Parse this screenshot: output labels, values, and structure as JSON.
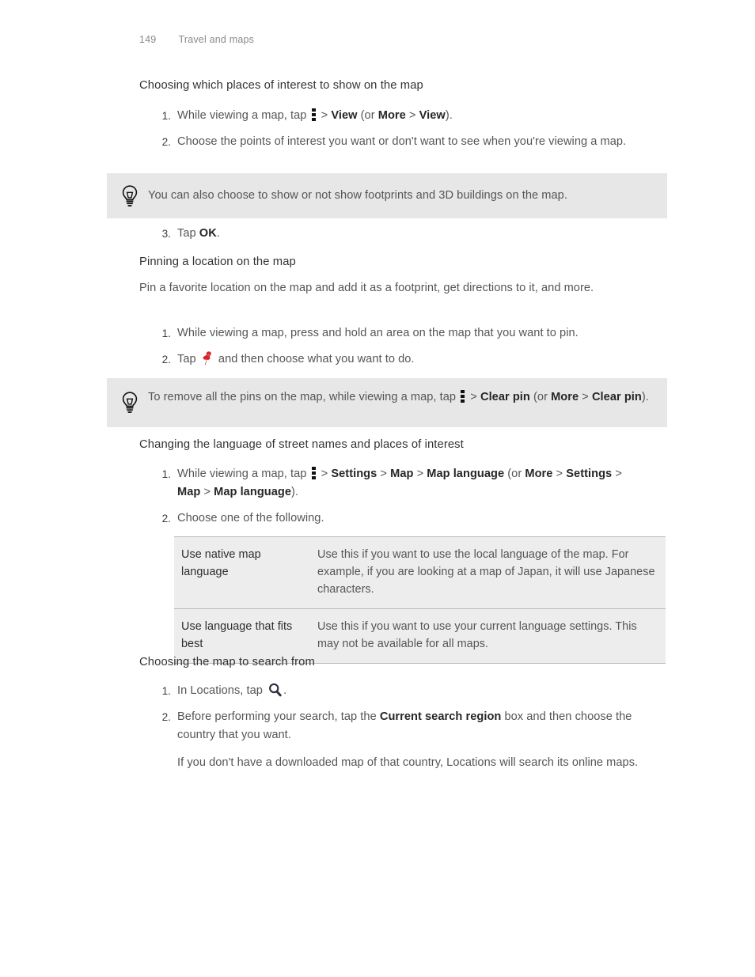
{
  "header": {
    "page_number": "149",
    "chapter": "Travel and maps"
  },
  "sections": [
    {
      "heading": "Choosing which places of interest to show on the map",
      "steps": [
        {
          "marker": "1.",
          "parts": [
            {
              "t": "text",
              "v": "While viewing a map, tap "
            },
            {
              "t": "icon",
              "v": "overflow-menu-icon"
            },
            {
              "t": "text",
              "v": " > "
            },
            {
              "t": "bold",
              "v": "View"
            },
            {
              "t": "text",
              "v": " (or "
            },
            {
              "t": "bold",
              "v": "More"
            },
            {
              "t": "text",
              "v": " > "
            },
            {
              "t": "bold",
              "v": "View"
            },
            {
              "t": "text",
              "v": ")."
            }
          ]
        },
        {
          "marker": "2.",
          "parts": [
            {
              "t": "text",
              "v": "Choose the points of interest you want or don't want to see when you're viewing a map."
            }
          ]
        }
      ]
    }
  ],
  "tip_1": {
    "icon": "lightbulb-icon",
    "text": "You can also choose to show or not show footprints and 3D buildings on the map."
  },
  "step_ok": {
    "marker": "3.",
    "pre": "Tap ",
    "bold": "OK",
    "post": "."
  },
  "section_pinning": {
    "heading": "Pinning a location on the map",
    "intro": "Pin a favorite location on the map and add it as a footprint, get directions to it, and more.",
    "steps": [
      {
        "marker": "1.",
        "text": "While viewing a map, press and hold an area on the map that you want to pin."
      },
      {
        "marker": "2.",
        "pre": "Tap ",
        "icon": "map-pin-icon",
        "post": " and then choose what you want to do."
      }
    ]
  },
  "tip_2": {
    "icon": "lightbulb-icon",
    "pre": "To remove all the pins on the map, while viewing a map, tap ",
    "icon_inline": "overflow-menu-icon",
    "mid1": " > ",
    "bold1": "Clear pin",
    "mid2": " (or ",
    "bold2": "More",
    "mid3": " > ",
    "bold3": "Clear pin",
    "post": ")."
  },
  "section_language": {
    "heading": "Changing the language of street names and places of interest",
    "step1": {
      "marker": "1.",
      "pre": "While viewing a map, tap ",
      "icon": "overflow-menu-icon",
      "seq": [
        {
          "t": "text",
          "v": " > "
        },
        {
          "t": "bold",
          "v": "Settings"
        },
        {
          "t": "text",
          "v": " > "
        },
        {
          "t": "bold",
          "v": "Map"
        },
        {
          "t": "text",
          "v": " > "
        },
        {
          "t": "bold",
          "v": "Map language"
        },
        {
          "t": "text",
          "v": " (or "
        },
        {
          "t": "bold",
          "v": "More"
        },
        {
          "t": "text",
          "v": " > "
        },
        {
          "t": "bold",
          "v": "Settings"
        },
        {
          "t": "text",
          "v": " > "
        },
        {
          "t": "bold",
          "v": "Map"
        },
        {
          "t": "text",
          "v": " > "
        },
        {
          "t": "bold",
          "v": "Map language"
        },
        {
          "t": "text",
          "v": ")."
        }
      ]
    },
    "step2": {
      "marker": "2.",
      "text": "Choose one of the following."
    },
    "options_table": {
      "rows": [
        {
          "term": "Use native map language",
          "description": "Use this if you want to use the local language of the map. For example, if you are looking at a map of Japan, it will use Japanese characters."
        },
        {
          "term": "Use language that fits best",
          "description": "Use this if you want to use your current language settings. This may not be available for all maps."
        }
      ]
    }
  },
  "section_search": {
    "heading": "Choosing the map to search from",
    "step1": {
      "marker": "1.",
      "pre": "In Locations, tap ",
      "icon": "search-icon",
      "post": "."
    },
    "step2": {
      "marker": "2.",
      "pre": "Before performing your search, tap the ",
      "bold": "Current search region",
      "post": " box and then choose the country that you want."
    },
    "note": "If you don't have a downloaded map of that country, Locations will search its online maps."
  },
  "colors": {
    "tip_background": "#e7e7e7",
    "table_background": "#ededed",
    "table_border": "#b9b9b9",
    "body_text": "#555555",
    "bold_text": "#262626",
    "heading_text": "#333333",
    "header_text": "#8a8a8a",
    "pin_red": "#d8232a",
    "search_icon": "#2b2b40"
  }
}
